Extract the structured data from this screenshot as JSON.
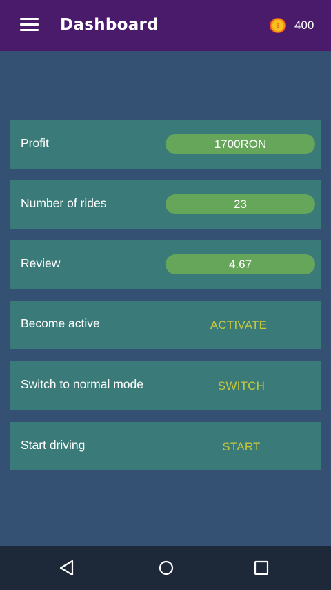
{
  "app_bar": {
    "title": "Dashboard",
    "coins": "400",
    "coin_symbol": "$"
  },
  "stats": {
    "profit": {
      "label": "Profit",
      "value": "1700RON"
    },
    "rides": {
      "label": "Number of rides",
      "value": "23"
    },
    "review": {
      "label": "Review",
      "value": "4.67"
    }
  },
  "actions": {
    "activate": {
      "label": "Become active",
      "button": "ACTIVATE"
    },
    "switch": {
      "label": "Switch to normal mode",
      "button": "SWITCH"
    },
    "start": {
      "label": "Start driving",
      "button": "START"
    }
  },
  "colors": {
    "app_bar": "#4a1a6b",
    "background": "#345072",
    "card": "#3a7b79",
    "pill": "#65a65a",
    "action_text": "#c6c83a",
    "nav_bar": "#1d2839"
  },
  "icons": {
    "menu": "hamburger-menu-icon",
    "coin": "coin-icon",
    "back": "back-triangle-icon",
    "home": "home-circle-icon",
    "recents": "recents-square-icon"
  }
}
